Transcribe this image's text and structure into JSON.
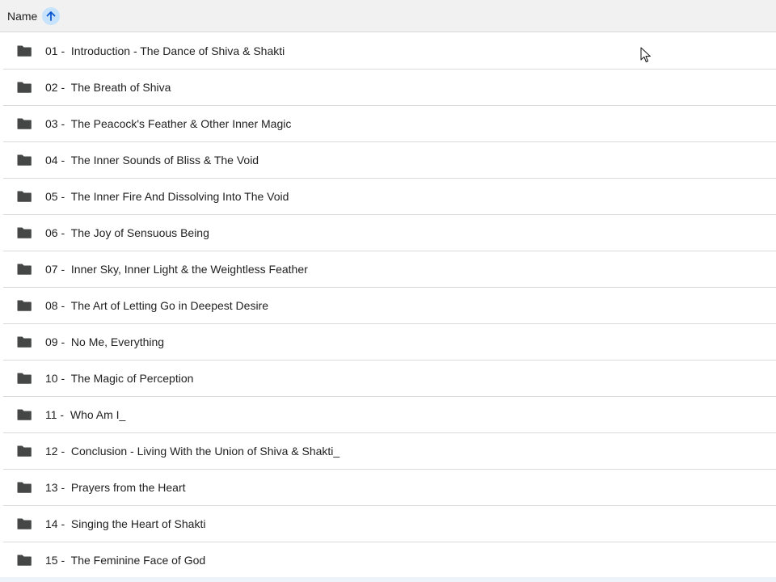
{
  "header": {
    "name_label": "Name",
    "sort_icon": "arrow-up-icon",
    "accent_color": "#0b57d0",
    "accent_bg": "#c7e2fb"
  },
  "rows": [
    {
      "label": "01 -  Introduction - The Dance of Shiva & Shakti",
      "icon": "folder-icon"
    },
    {
      "label": "02 -  The Breath of Shiva",
      "icon": "folder-icon"
    },
    {
      "label": "03 -  The Peacock's Feather & Other Inner Magic",
      "icon": "folder-icon"
    },
    {
      "label": "04 -  The Inner Sounds of Bliss & The Void",
      "icon": "folder-icon"
    },
    {
      "label": "05 -  The Inner Fire And Dissolving Into The Void",
      "icon": "folder-icon"
    },
    {
      "label": "06 -  The Joy of Sensuous Being",
      "icon": "folder-icon"
    },
    {
      "label": "07 -  Inner Sky, Inner Light & the Weightless Feather",
      "icon": "folder-icon"
    },
    {
      "label": "08 -  The Art of Letting Go in Deepest Desire",
      "icon": "folder-icon"
    },
    {
      "label": "09 -  No Me, Everything",
      "icon": "folder-icon"
    },
    {
      "label": "10 -  The Magic of Perception",
      "icon": "folder-icon"
    },
    {
      "label": "11 -  Who Am I_",
      "icon": "folder-icon"
    },
    {
      "label": "12 -  Conclusion - Living With the Union of Shiva & Shakti_",
      "icon": "folder-icon"
    },
    {
      "label": "13 -  Prayers from the Heart",
      "icon": "folder-icon"
    },
    {
      "label": "14 -  Singing the Heart of Shakti",
      "icon": "folder-icon"
    },
    {
      "label": "15 -  The Feminine Face of God",
      "icon": "folder-icon"
    }
  ],
  "colors": {
    "folder": "#444746",
    "divider": "#d9d9d9",
    "header_bg": "#f1f1f1"
  }
}
